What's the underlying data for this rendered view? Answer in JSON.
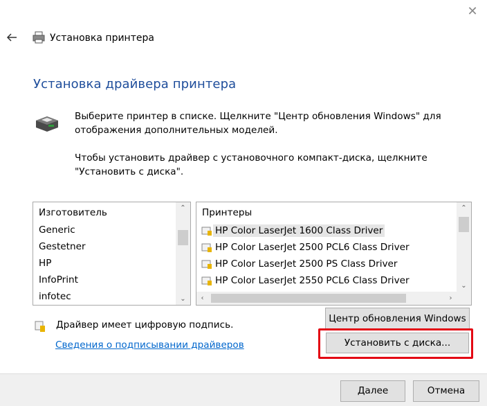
{
  "window": {
    "title": "Установка принтера",
    "close_glyph": "✕"
  },
  "page": {
    "heading": "Установка драйвера принтера",
    "instruction_1": "Выберите принтер в списке. Щелкните \"Центр обновления Windows\" для отображения дополнительных моделей.",
    "instruction_2": "Чтобы установить драйвер с установочного компакт-диска, щелкните \"Установить с диска\"."
  },
  "manufacturers": {
    "header": "Изготовитель",
    "items": [
      "Generic",
      "Gestetner",
      "HP",
      "InfoPrint",
      "infotec"
    ],
    "selected": "HP"
  },
  "printers": {
    "header": "Принтеры",
    "items": [
      "HP Color LaserJet 1600 Class Driver",
      "HP Color LaserJet 2500 PCL6 Class Driver",
      "HP Color LaserJet 2500 PS Class Driver",
      "HP Color LaserJet 2550 PCL6 Class Driver"
    ],
    "selected": "HP Color LaserJet 1600 Class Driver"
  },
  "signature": {
    "text": "Драйвер имеет цифровую подпись.",
    "link": "Сведения о подписывании драйверов"
  },
  "buttons": {
    "windows_update": "Центр обновления Windows",
    "have_disk": "Установить с диска...",
    "next": "Далее",
    "cancel": "Отмена"
  },
  "colors": {
    "heading": "#1e4d9b",
    "link": "#0066cc",
    "highlight": "#e30613"
  }
}
